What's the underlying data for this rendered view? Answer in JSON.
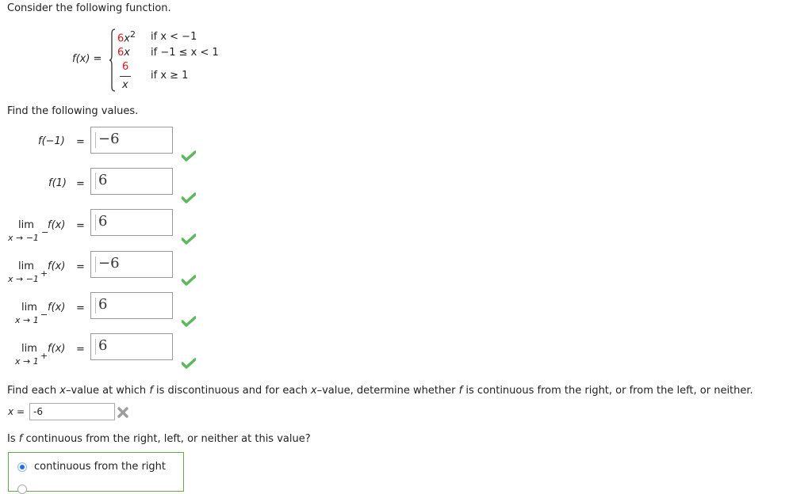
{
  "intro": "Consider the following function.",
  "function": {
    "name": "f(x) =",
    "pieces": [
      {
        "expr_coef": "6",
        "expr_var": "x",
        "expr_exp": "2",
        "condition": "if x < −1"
      },
      {
        "expr_coef": "6",
        "expr_var": "x",
        "condition": "if −1 ≤ x < 1"
      },
      {
        "numerator": "6",
        "denominator": "x",
        "condition": "if x ≥ 1"
      }
    ]
  },
  "find_values": {
    "heading": "Find the following values.",
    "items": [
      {
        "label": "f(−1)",
        "equals": "=",
        "answer": "−6",
        "status": "correct"
      },
      {
        "label": "f(1)",
        "equals": "=",
        "answer": "6",
        "status": "correct"
      },
      {
        "label_lim": "lim",
        "label_sub": "x → −1",
        "label_side": "−",
        "label_fx": "f(x)",
        "equals": "=",
        "answer": "6",
        "status": "correct"
      },
      {
        "label_lim": "lim",
        "label_sub": "x → −1",
        "label_side": "+",
        "label_fx": "f(x)",
        "equals": "=",
        "answer": "−6",
        "status": "correct"
      },
      {
        "label_lim": "lim",
        "label_sub": "x → 1",
        "label_side": "−",
        "label_fx": "f(x)",
        "equals": "=",
        "answer": "6",
        "status": "correct"
      },
      {
        "label_lim": "lim",
        "label_sub": "x → 1",
        "label_side": "+",
        "label_fx": "f(x)",
        "equals": "=",
        "answer": "6",
        "status": "correct"
      }
    ]
  },
  "discontinuity": {
    "prompt_part1": "Find each ",
    "prompt_x": "x",
    "prompt_part2": "–value at which ",
    "prompt_f": "f",
    "prompt_part3": " is discontinuous and for each ",
    "prompt_x2": "x",
    "prompt_part4": "–value, determine whether ",
    "prompt_f2": "f",
    "prompt_part5": " is continuous from the right, or from the left, or neither.",
    "x_label": "x",
    "x_equals": "=",
    "x_value": "-6",
    "x_status": "incorrect",
    "question_part1": "Is ",
    "question_f": "f",
    "question_part2": " continuous from the right, left, or neither at this value?",
    "options": [
      {
        "label": "continuous from the right",
        "selected": true
      }
    ]
  },
  "colors": {
    "correct": "#5cb85c",
    "incorrect": "#9e9e9e",
    "highlight": "#e0161b",
    "selected_radio": "#1a73e8",
    "choice_border": "#6aa84f"
  }
}
